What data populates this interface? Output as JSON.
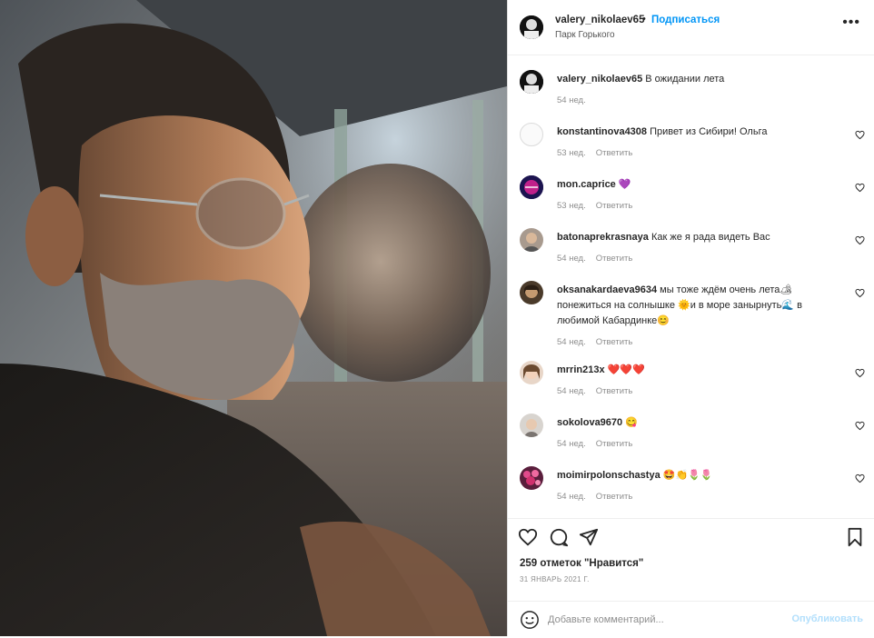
{
  "post": {
    "username": "valery_nikolaev65",
    "dot": "•",
    "follow_label": "Подписаться",
    "location": "Парк Горького",
    "more_icon": "more-horizontal-icon",
    "more_text": "•••"
  },
  "caption": {
    "username": "valery_nikolaev65",
    "text": "В ожидании лета",
    "time": "54 нед."
  },
  "reply_label": "Ответить",
  "comments": [
    {
      "username": "konstantinova4308",
      "text": "Привет из Сибири! Ольга",
      "time": "53 нед."
    },
    {
      "username": "mon.caprice",
      "text": "💜",
      "time": "53 нед."
    },
    {
      "username": "batonaprekrasnaya",
      "text": "Как же я рада видеть Вас",
      "time": "54 нед."
    },
    {
      "username": "oksanakardaeva9634",
      "text": "мы тоже ждём очень лета🏕 понежиться на солнышке 🌞и в море занырнуть🌊 в любимой Кабардинке😊",
      "time": "54 нед."
    },
    {
      "username": "mrrin213x",
      "text": "❤️❤️❤️",
      "time": "54 нед."
    },
    {
      "username": "sokolova9670",
      "text": "😋",
      "time": "54 нед."
    },
    {
      "username": "moimirpolonschastya",
      "text": "🤩👏🌷🌷",
      "time": "54 нед."
    }
  ],
  "likes": "259 отметок \"Нравится\"",
  "date": "31 ЯНВАРЬ 2021 Г.",
  "add_comment": {
    "placeholder": "Добавьте комментарий...",
    "publish_label": "Опубликовать"
  },
  "colors": {
    "link_blue": "#0095f6",
    "publish_disabled": "#b2dffc",
    "secondary_text": "#8e8e8e",
    "border": "#dbdbdb"
  }
}
